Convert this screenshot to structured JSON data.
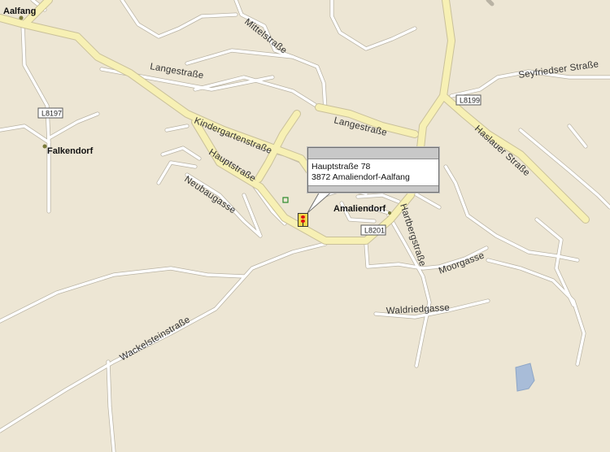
{
  "map": {
    "places": {
      "aalfang": "Aalfang",
      "falkendorf": "Falkendorf",
      "amaliendorf": "Amaliendorf"
    },
    "streets": {
      "mittelstrasse": "Mittelstraße",
      "langestrasse_1": "Langestraße",
      "langestrasse_2": "Langestraße",
      "kindergartenstrasse": "Kindergartenstraße",
      "hauptstrasse": "Hauptstraße",
      "neubaugasse": "Neubaugasse",
      "seyfriedser_strasse": "Seyfriedser Straße",
      "haslauer_strasse": "Haslauer Straße",
      "hartbergstrasse": "Hartbergstraße",
      "moorgasse": "Moorgasse",
      "waldriedgasse": "Waldriedgasse",
      "wackelsteinstrasse": "Wackelsteinstraße"
    },
    "road_shields": {
      "l8197": "L8197",
      "l8199": "L8199",
      "l8201": "L8201"
    },
    "popup": {
      "line1": "Hauptstraße 78",
      "line2": "3872 Amaliendorf-Aalfang"
    },
    "marker_icon": "traffic-light-pin-icon",
    "colors": {
      "background": "#ede6d4",
      "major_road": "#f7f0b4",
      "minor_road": "#ffffff",
      "water": "#a8bcd8"
    }
  }
}
